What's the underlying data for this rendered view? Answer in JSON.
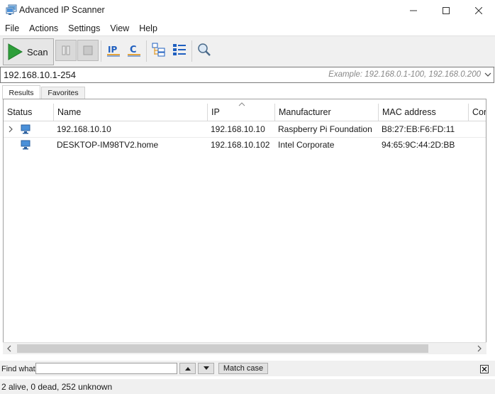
{
  "window": {
    "title": "Advanced IP Scanner"
  },
  "menu": [
    "File",
    "Actions",
    "Settings",
    "View",
    "Help"
  ],
  "toolbar": {
    "scan_label": "Scan"
  },
  "address": {
    "value": "192.168.10.1-254",
    "example": "Example: 192.168.0.1-100, 192.168.0.200"
  },
  "tabs": {
    "results": "Results",
    "favorites": "Favorites"
  },
  "table": {
    "columns": [
      "Status",
      "Name",
      "IP",
      "Manufacturer",
      "MAC address",
      "Cor"
    ],
    "rows": [
      {
        "name": "192.168.10.10",
        "ip": "192.168.10.10",
        "manufacturer": "Raspberry Pi Foundation",
        "mac": "B8:27:EB:F6:FD:11"
      },
      {
        "name": "DESKTOP-IM98TV2.home",
        "ip": "192.168.10.102",
        "manufacturer": "Intel Corporate",
        "mac": "94:65:9C:44:2D:BB"
      }
    ]
  },
  "find": {
    "label": "Find what:",
    "value": "",
    "match_case": "Match case"
  },
  "status": "2 alive, 0 dead, 252 unknown",
  "colors": {
    "play_green": "#2e9e3a",
    "accent_blue": "#1f5fbf",
    "toolbar_bg": "#f0f0f0"
  }
}
